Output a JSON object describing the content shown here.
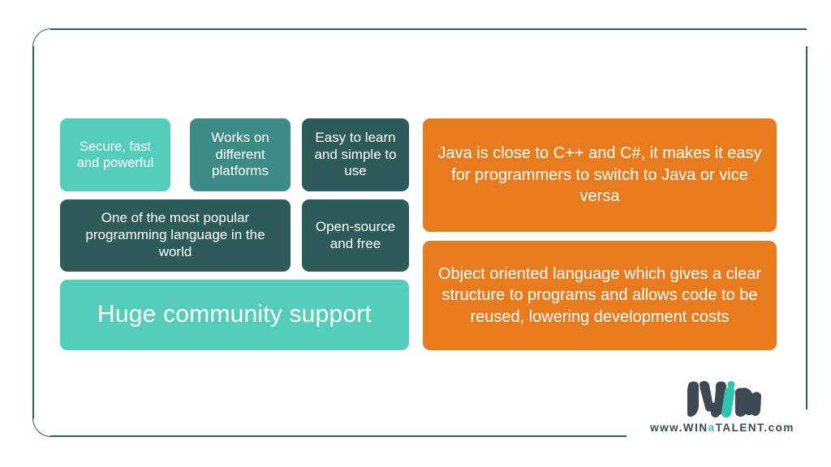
{
  "slide": {
    "background_color": "#ffffff",
    "frame_color": "#2f6260"
  },
  "palette": {
    "mint": "#55cdbb",
    "mid_teal": "#3d8b85",
    "dark_teal": "#2d5b5a",
    "orange": "#e87b1e",
    "logo_dark": "#3d4852",
    "logo_accent": "#2ec4b0"
  },
  "cards": {
    "secure": "Secure, fast and powerful",
    "platforms": "Works on different platforms",
    "easy": "Easy to learn and simple to use",
    "popular": "One of the most popular programming language in the world",
    "opensource": "Open-source and free",
    "community": "Huge community support",
    "java_cpp": "Java is close to C++ and C#, it makes it easy for programmers to switch to Java or vice versa",
    "oop": "Object oriented language which gives a clear structure to programs and allows code to be reused, lowering development costs"
  },
  "logo": {
    "wordmark": "win",
    "url_prefix": "www.",
    "url_win": "WIN",
    "url_a": "a",
    "url_talent": "TALENT",
    "url_suffix": ".com",
    "url_full": "www.WINaTALENT.com"
  }
}
